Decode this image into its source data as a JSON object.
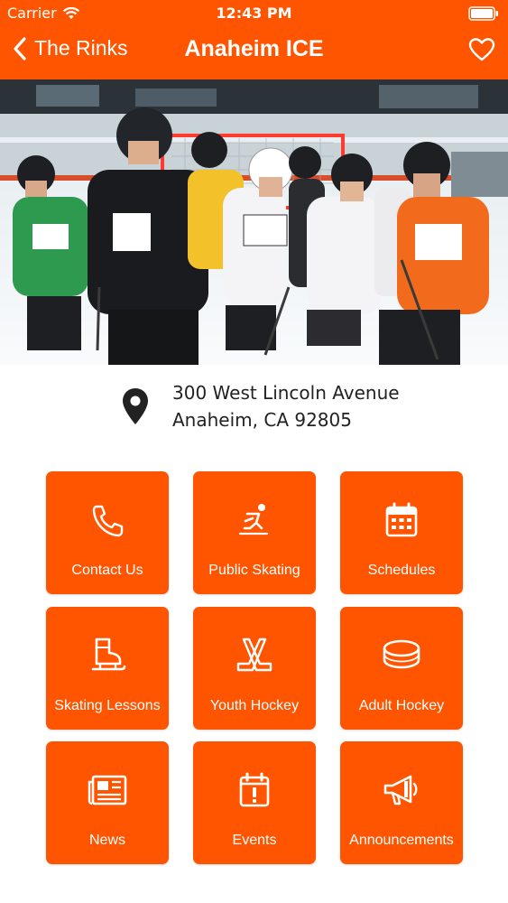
{
  "status_bar": {
    "carrier": "Carrier",
    "time": "12:43 PM"
  },
  "nav": {
    "back_label": "The Rinks",
    "title": "Anaheim ICE"
  },
  "address": {
    "line1": "300 West Lincoln Avenue",
    "line2": "Anaheim, CA 92805"
  },
  "tiles": [
    {
      "label": "Contact Us",
      "icon": "phone-icon"
    },
    {
      "label": "Public Skating",
      "icon": "skater-icon"
    },
    {
      "label": "Schedules",
      "icon": "calendar-icon"
    },
    {
      "label": "Skating Lessons",
      "icon": "skate-icon"
    },
    {
      "label": "Youth Hockey",
      "icon": "crossed-sticks-icon"
    },
    {
      "label": "Adult Hockey",
      "icon": "puck-icon"
    },
    {
      "label": "News",
      "icon": "newspaper-icon"
    },
    {
      "label": "Events",
      "icon": "event-calendar-icon"
    },
    {
      "label": "Announcements",
      "icon": "megaphone-icon"
    }
  ],
  "colors": {
    "accent": "#FF5500",
    "text": "#222222",
    "background": "#FFFFFF"
  }
}
